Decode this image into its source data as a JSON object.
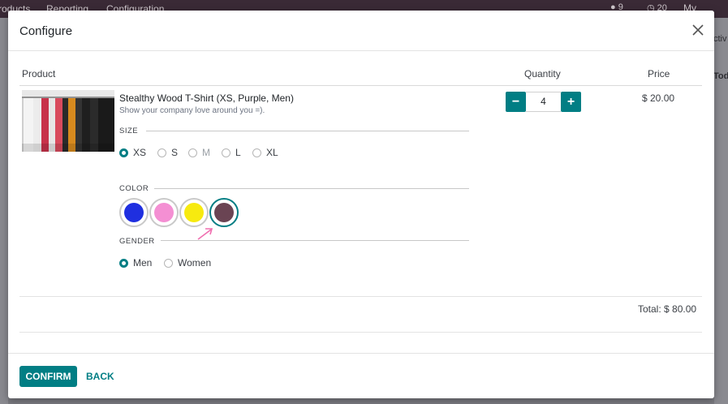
{
  "background": {
    "menu_items": [
      "roducts",
      "Reporting",
      "Configuration"
    ],
    "chat_count": "9",
    "activity_count": "20",
    "company": "My Compa",
    "fragments": [
      "ctiv",
      "Tod"
    ]
  },
  "modal": {
    "title": "Configure",
    "columns": {
      "product": "Product",
      "quantity": "Quantity",
      "price": "Price"
    },
    "product": {
      "name": "Stealthy Wood T-Shirt (XS, Purple, Men)",
      "description": "Show your company love around you =).",
      "image_icon": "tshirts-rack-image"
    },
    "attributes": {
      "size": {
        "label": "SIZE",
        "options": [
          "XS",
          "S",
          "M",
          "L",
          "XL"
        ],
        "selected": "XS"
      },
      "color": {
        "label": "COLOR",
        "swatches": [
          {
            "name": "Blue",
            "hex": "#1f2fe0"
          },
          {
            "name": "Pink",
            "hex": "#f48fd3"
          },
          {
            "name": "Yellow",
            "hex": "#f7ea0f"
          },
          {
            "name": "Purple",
            "hex": "#6a4453"
          }
        ],
        "selected": "Purple"
      },
      "gender": {
        "label": "GENDER",
        "options": [
          "Men",
          "Women"
        ],
        "selected": "Men"
      }
    },
    "quantity": {
      "value": "4",
      "minus": "−",
      "plus": "+"
    },
    "price": "$ 20.00",
    "total": "Total: $ 80.00",
    "buttons": {
      "confirm": "CONFIRM",
      "back": "BACK"
    }
  },
  "colors": {
    "accent": "#017e84",
    "pointer": "#f06fb0"
  }
}
